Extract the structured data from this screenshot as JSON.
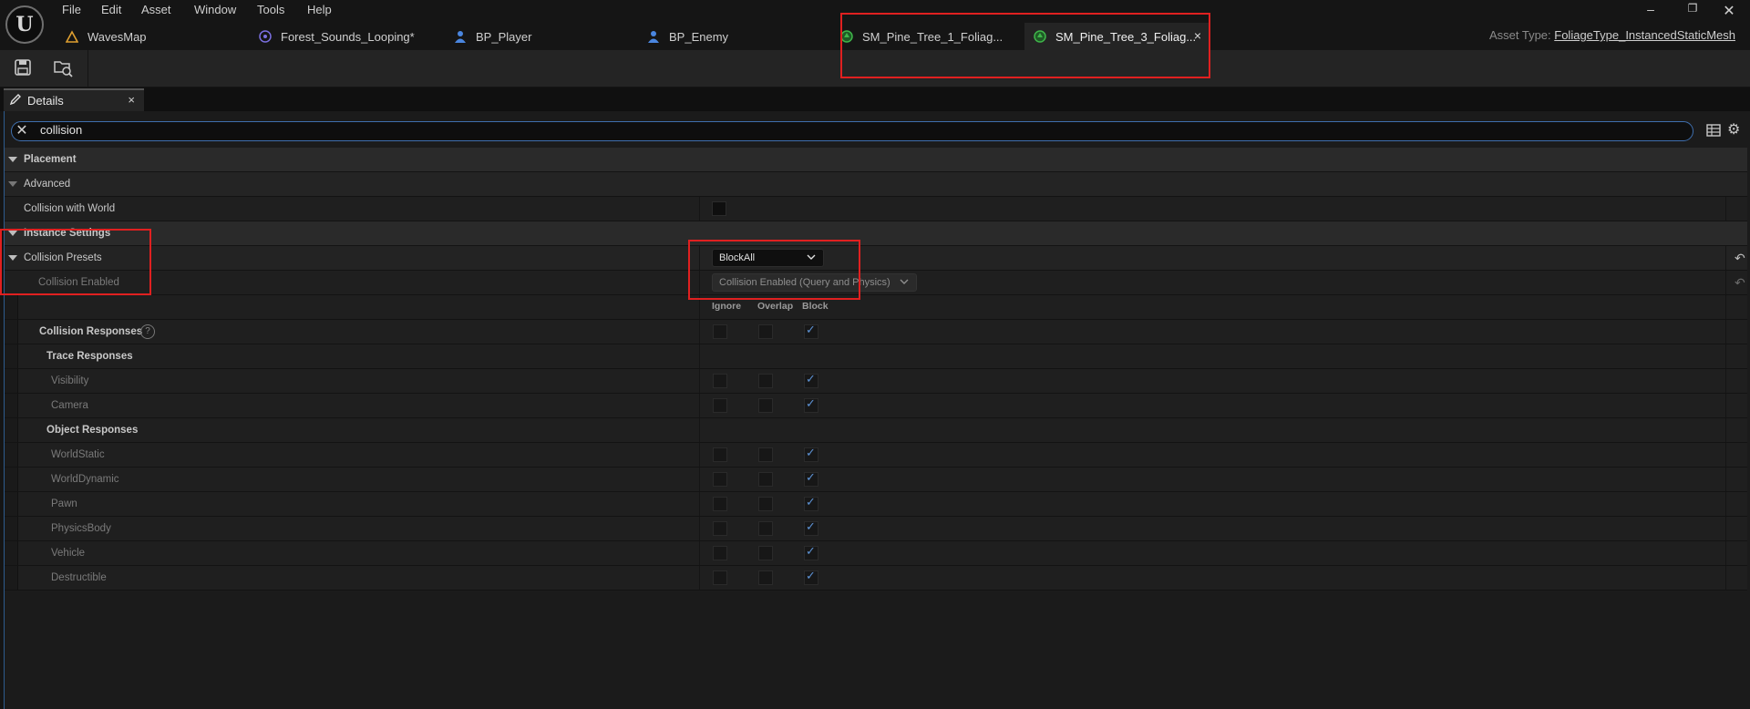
{
  "menu": [
    "File",
    "Edit",
    "Asset",
    "Window",
    "Tools",
    "Help"
  ],
  "tabs": [
    {
      "label": "WavesMap",
      "icon": "map-icon",
      "color": "#e0a030"
    },
    {
      "label": "Forest_Sounds_Looping*",
      "icon": "sound-cue-icon",
      "color": "#7a6fe0"
    },
    {
      "label": "BP_Player",
      "icon": "blueprint-pawn-icon",
      "color": "#4a86e0"
    },
    {
      "label": "BP_Enemy",
      "icon": "blueprint-pawn-icon",
      "color": "#4a86e0"
    },
    {
      "label": "SM_Pine_Tree_1_Foliag...",
      "icon": "foliage-icon",
      "color": "#3fb54a"
    },
    {
      "label": "SM_Pine_Tree_3_Foliag...",
      "icon": "foliage-icon",
      "color": "#3fb54a",
      "active": true,
      "close": "×"
    }
  ],
  "asset_type": {
    "label": "Asset Type:",
    "value": "FoliageType_InstancedStaticMesh"
  },
  "details_tab": {
    "label": "Details",
    "close": "×"
  },
  "search": {
    "value": "collision"
  },
  "categories": {
    "placement": "Placement",
    "advanced": "Advanced",
    "instance_settings": "Instance Settings"
  },
  "props": {
    "collision_with_world": "Collision with World",
    "collision_with_world_checked": false,
    "collision_presets": "Collision Presets",
    "collision_presets_value": "BlockAll",
    "collision_enabled": "Collision Enabled",
    "collision_enabled_value": "Collision Enabled (Query and Physics)",
    "collision_responses": "Collision Responses",
    "trace_responses": "Trace Responses",
    "object_responses": "Object Responses"
  },
  "response_headers": [
    "Ignore",
    "Overlap",
    "Block"
  ],
  "collision_responses_value": "Block",
  "trace_channels": [
    {
      "name": "Visibility",
      "value": "Block"
    },
    {
      "name": "Camera",
      "value": "Block"
    }
  ],
  "object_channels": [
    {
      "name": "WorldStatic",
      "value": "Block"
    },
    {
      "name": "WorldDynamic",
      "value": "Block"
    },
    {
      "name": "Pawn",
      "value": "Block"
    },
    {
      "name": "PhysicsBody",
      "value": "Block"
    },
    {
      "name": "Vehicle",
      "value": "Block"
    },
    {
      "name": "Destructible",
      "value": "Block"
    }
  ],
  "colors": {
    "accent": "#3f6fae",
    "highlight": "#e02020",
    "check": "#5d92d4"
  }
}
